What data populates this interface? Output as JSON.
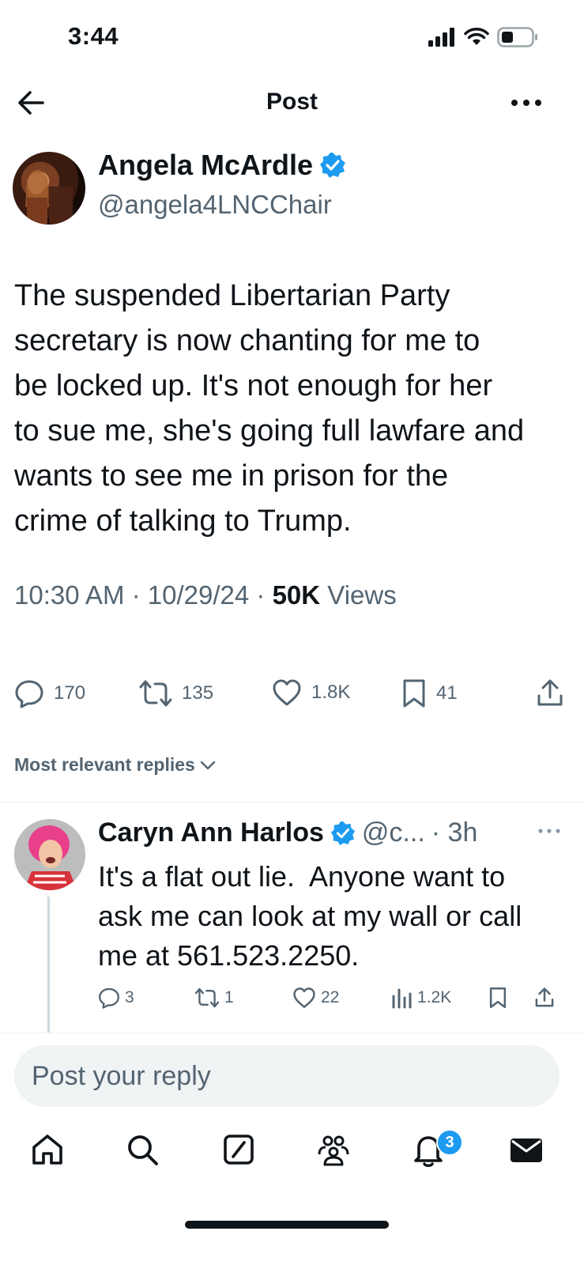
{
  "status_bar": {
    "time": "3:44"
  },
  "header": {
    "title": "Post"
  },
  "post": {
    "author_name": "Angela McArdle",
    "author_handle": "@angela4LNCChair",
    "text": "The suspended Libertarian Party\nsecretary is now chanting for me to\nbe locked up. It's not enough for her\nto sue me, she's going full lawfare and\nwants to see me in prison for the\ncrime of talking to Trump.",
    "time": "10:30 AM",
    "date": "10/29/24",
    "views_count": "50K",
    "views_label": "Views",
    "sep": " · ",
    "stats": {
      "replies": "170",
      "reposts": "135",
      "likes": "1.8K",
      "bookmarks": "41"
    }
  },
  "replies_filter": {
    "label": "Most relevant replies"
  },
  "reply": {
    "author_name": "Caryn Ann Harlos",
    "author_handle": "@c...",
    "age": "· 3h",
    "text": "It's a flat out lie.  Anyone want to\nask me can look at my wall or call\nme at 561.523.2250.",
    "stats": {
      "replies": "3",
      "reposts": "1",
      "likes": "22",
      "views": "1.2K"
    }
  },
  "compose": {
    "placeholder": "Post your reply"
  },
  "nav": {
    "notifications_badge": "3"
  },
  "colors": {
    "accent": "#1d9bf0",
    "text": "#0f1419",
    "muted": "#536471"
  }
}
